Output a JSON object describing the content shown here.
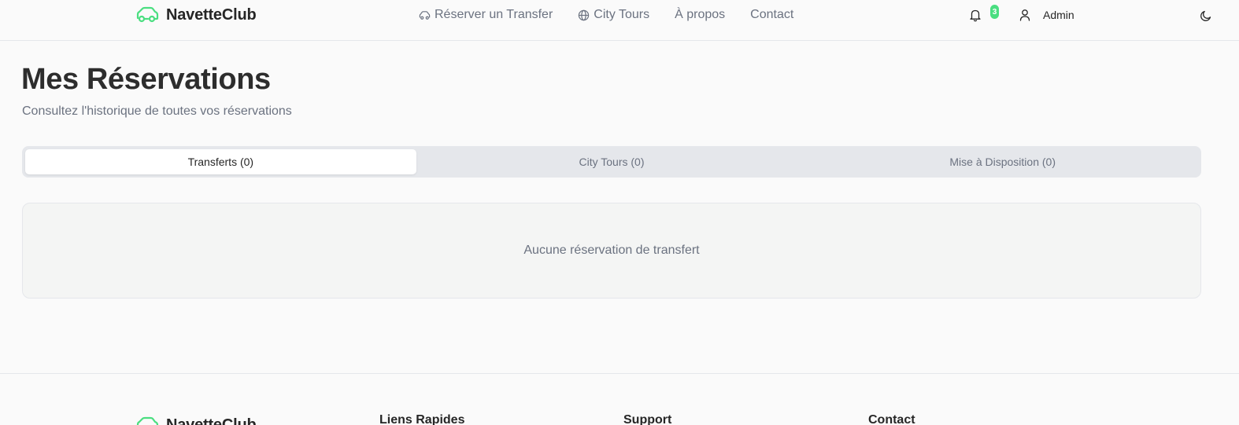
{
  "header": {
    "brand": "NavetteClub",
    "nav": [
      {
        "label": "Réserver un Transfer",
        "icon": "car-icon"
      },
      {
        "label": "City Tours",
        "icon": "globe-icon"
      },
      {
        "label": "À propos"
      },
      {
        "label": "Contact"
      }
    ],
    "notifications_count": "3",
    "user_name": "Admin"
  },
  "main": {
    "title": "Mes Réservations",
    "subtitle": "Consultez l'historique de toutes vos réservations",
    "tabs": [
      {
        "label": "Transferts (0)",
        "active": true
      },
      {
        "label": "City Tours (0)",
        "active": false
      },
      {
        "label": "Mise à Disposition (0)",
        "active": false
      }
    ],
    "empty_message": "Aucune réservation de transfert"
  },
  "footer": {
    "brand": "NavetteClub",
    "headings": [
      "Liens Rapides",
      "Support",
      "Contact"
    ]
  },
  "colors": {
    "accent": "#4ade80",
    "text_muted": "#6b7280",
    "tab_bg": "#e5e7eb"
  }
}
